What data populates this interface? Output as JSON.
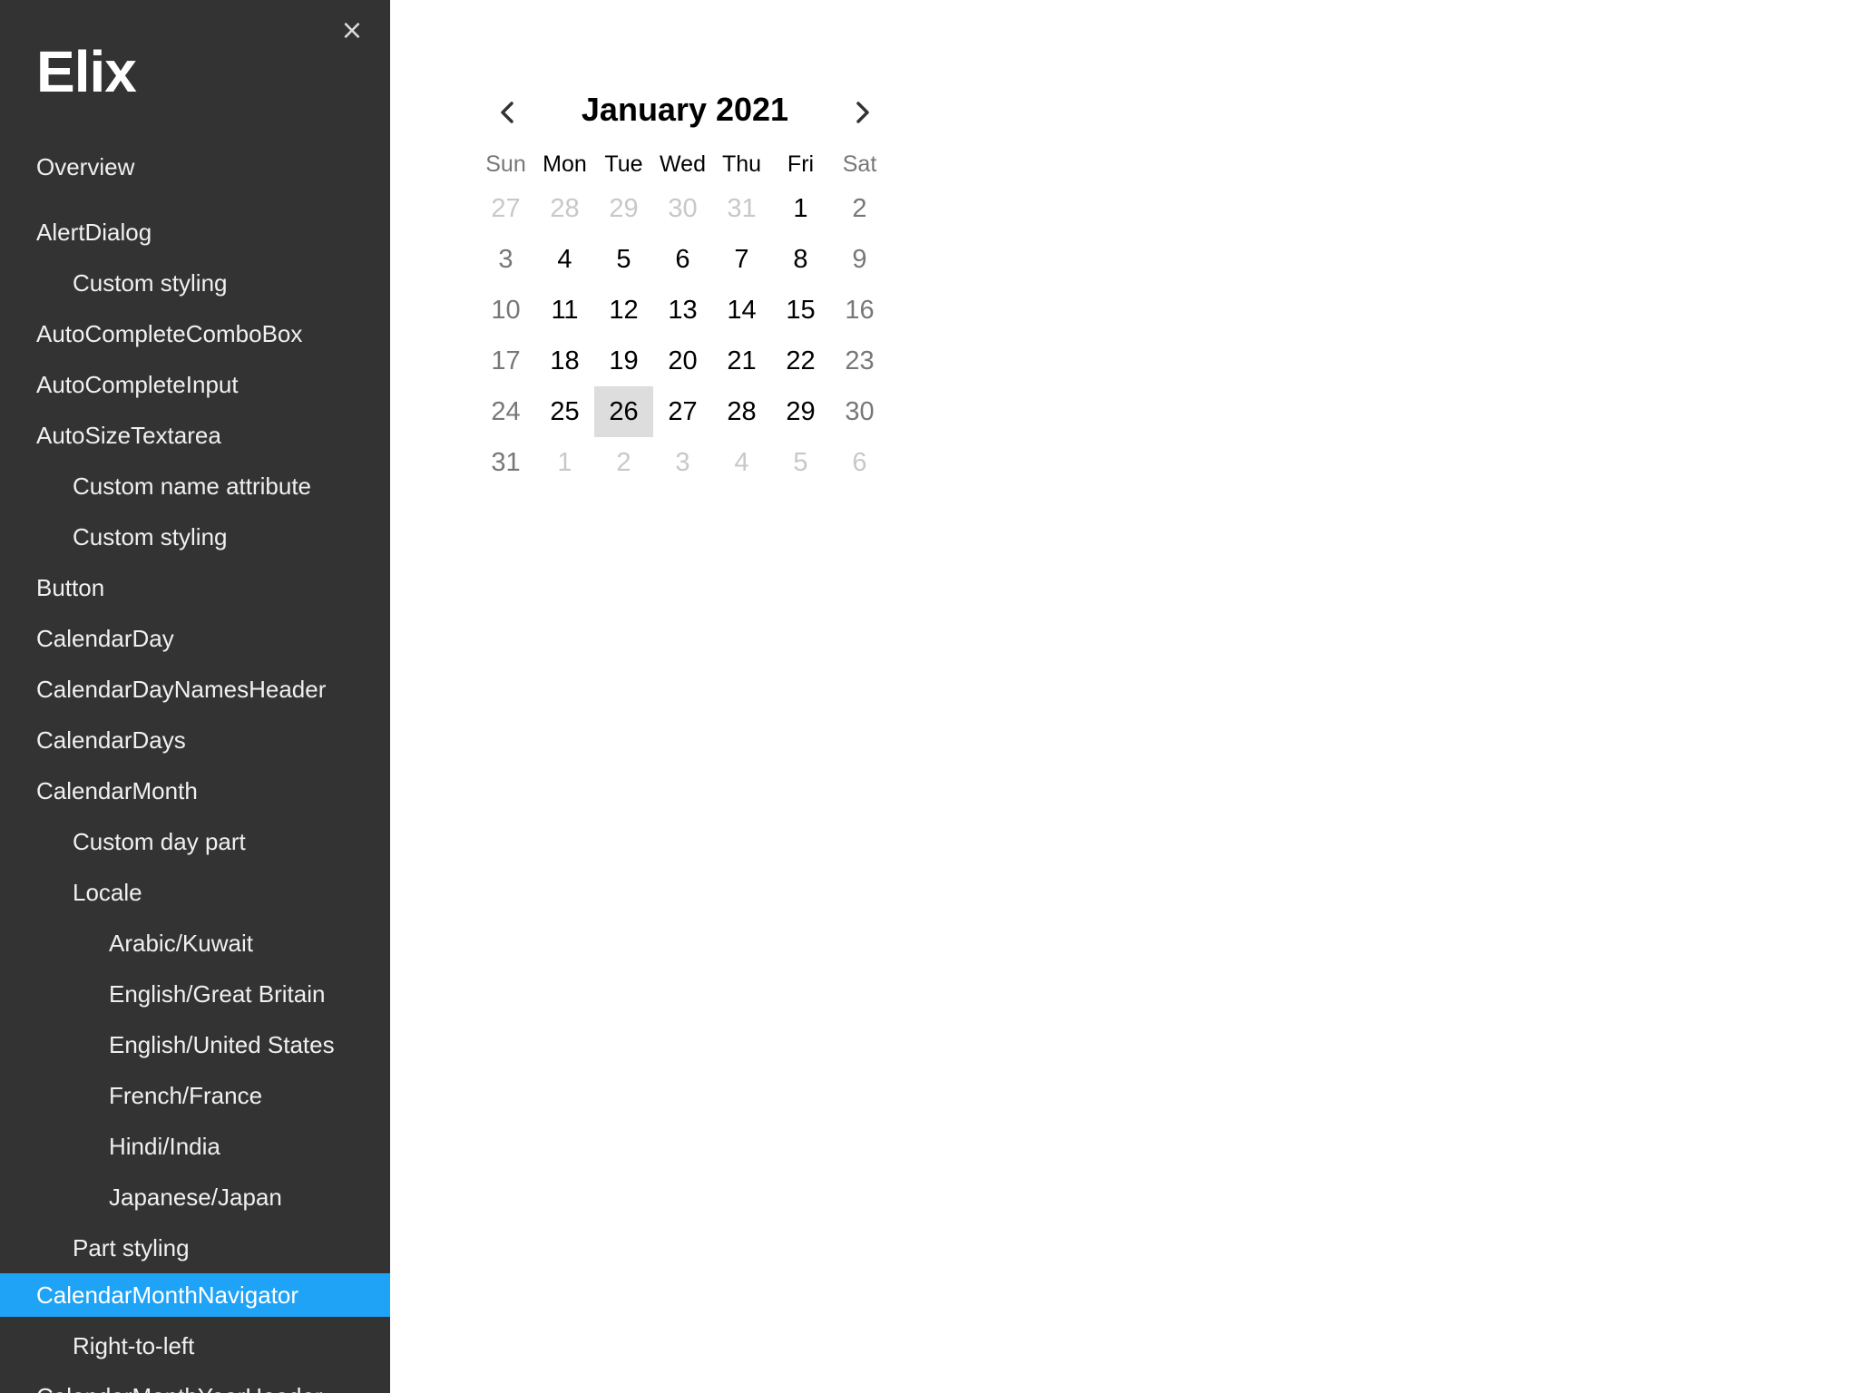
{
  "sidebar": {
    "brand": "Elix",
    "close_glyph": "×",
    "selected_color": "#1fa3f7",
    "items": [
      {
        "label": "Overview",
        "level": 0
      },
      {
        "label": "AlertDialog",
        "level": 0
      },
      {
        "label": "Custom styling",
        "level": 1
      },
      {
        "label": "AutoCompleteComboBox",
        "level": 0
      },
      {
        "label": "AutoCompleteInput",
        "level": 0
      },
      {
        "label": "AutoSizeTextarea",
        "level": 0
      },
      {
        "label": "Custom name attribute",
        "level": 1
      },
      {
        "label": "Custom styling",
        "level": 1
      },
      {
        "label": "Button",
        "level": 0
      },
      {
        "label": "CalendarDay",
        "level": 0
      },
      {
        "label": "CalendarDayNamesHeader",
        "level": 0
      },
      {
        "label": "CalendarDays",
        "level": 0
      },
      {
        "label": "CalendarMonth",
        "level": 0
      },
      {
        "label": "Custom day part",
        "level": 1
      },
      {
        "label": "Locale",
        "level": 1
      },
      {
        "label": "Arabic/Kuwait",
        "level": 2
      },
      {
        "label": "English/Great Britain",
        "level": 2
      },
      {
        "label": "English/United States",
        "level": 2
      },
      {
        "label": "French/France",
        "level": 2
      },
      {
        "label": "Hindi/India",
        "level": 2
      },
      {
        "label": "Japanese/Japan",
        "level": 2
      },
      {
        "label": "Part styling",
        "level": 1
      },
      {
        "label": "CalendarMonthNavigator",
        "level": 0,
        "selected": true
      },
      {
        "label": "Right-to-left",
        "level": 1
      },
      {
        "label": "CalendarMonthYearHeader",
        "level": 0
      }
    ]
  },
  "calendar": {
    "title": "January 2021",
    "prev_icon": "chevron-left-icon",
    "next_icon": "chevron-right-icon",
    "day_names": [
      "Sun",
      "Mon",
      "Tue",
      "Wed",
      "Thu",
      "Fri",
      "Sat"
    ],
    "weeks": [
      [
        {
          "d": "27",
          "o": true
        },
        {
          "d": "28",
          "o": true
        },
        {
          "d": "29",
          "o": true
        },
        {
          "d": "30",
          "o": true
        },
        {
          "d": "31",
          "o": true
        },
        {
          "d": "1"
        },
        {
          "d": "2"
        }
      ],
      [
        {
          "d": "3"
        },
        {
          "d": "4"
        },
        {
          "d": "5"
        },
        {
          "d": "6"
        },
        {
          "d": "7"
        },
        {
          "d": "8"
        },
        {
          "d": "9"
        }
      ],
      [
        {
          "d": "10"
        },
        {
          "d": "11"
        },
        {
          "d": "12"
        },
        {
          "d": "13"
        },
        {
          "d": "14"
        },
        {
          "d": "15"
        },
        {
          "d": "16"
        }
      ],
      [
        {
          "d": "17"
        },
        {
          "d": "18"
        },
        {
          "d": "19"
        },
        {
          "d": "20"
        },
        {
          "d": "21"
        },
        {
          "d": "22"
        },
        {
          "d": "23"
        }
      ],
      [
        {
          "d": "24"
        },
        {
          "d": "25"
        },
        {
          "d": "26",
          "today": true
        },
        {
          "d": "27"
        },
        {
          "d": "28"
        },
        {
          "d": "29"
        },
        {
          "d": "30"
        }
      ],
      [
        {
          "d": "31"
        },
        {
          "d": "1",
          "o": true
        },
        {
          "d": "2",
          "o": true
        },
        {
          "d": "3",
          "o": true
        },
        {
          "d": "4",
          "o": true
        },
        {
          "d": "5",
          "o": true
        },
        {
          "d": "6",
          "o": true
        }
      ]
    ]
  }
}
